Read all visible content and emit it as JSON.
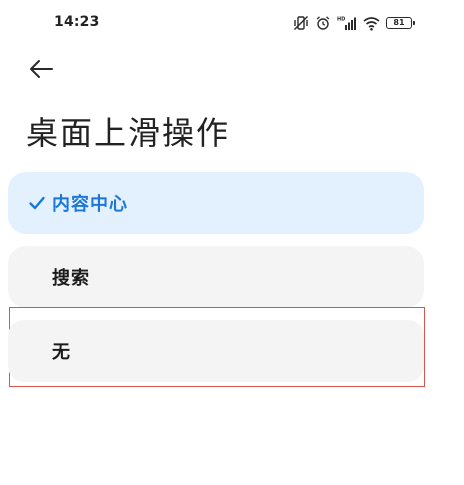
{
  "status_bar": {
    "time": "14:23",
    "icons": [
      "vibrate-off-icon",
      "alarm-icon",
      "hd-signal-icon",
      "wifi-icon",
      "battery-icon"
    ],
    "battery_level": "81"
  },
  "header": {
    "back_icon": "arrow-left-icon",
    "title": "桌面上滑操作"
  },
  "options": [
    {
      "label": "内容中心",
      "selected": true
    },
    {
      "label": "搜索",
      "selected": false
    },
    {
      "label": "无",
      "selected": false
    }
  ],
  "colors": {
    "accent": "#1b78d8",
    "selected_bg": "#e3f0fd",
    "option_bg": "#f4f4f4",
    "highlight_border": "#d9534f"
  }
}
